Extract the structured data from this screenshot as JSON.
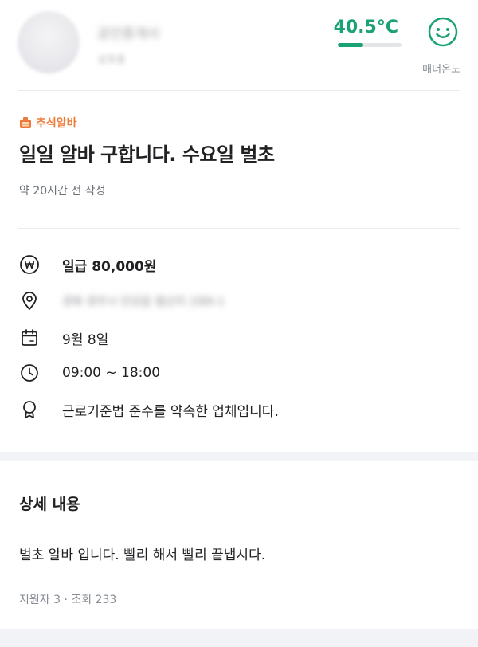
{
  "profile": {
    "name": "공인중개사",
    "region": "성포동",
    "manner_temperature": "40.5°C",
    "manner_level": 0.4,
    "manner_label": "매너온도",
    "temp_color": "#1aa174"
  },
  "post": {
    "badge_icon": "chuseok-icon",
    "badge_label": "추석알바",
    "badge_color": "#ee7a3a",
    "title": "일일 알바 구합니다. 수요일 벌초",
    "posted_time": "약 20시간 전 작성"
  },
  "info": {
    "wage": "일급 80,000원",
    "location": "경북 경주시 안강읍 월산리 산89-1",
    "date": "9월 8일",
    "time": "09:00 ~ 18:00",
    "certification": "근로기준법 준수를 약속한 업체입니다."
  },
  "details": {
    "section_title": "상세 내용",
    "body": "벌초 알바 입니다. 빨리 해서 빨리 끝냅시다.",
    "stats": "지원자 3 · 조회 233"
  }
}
